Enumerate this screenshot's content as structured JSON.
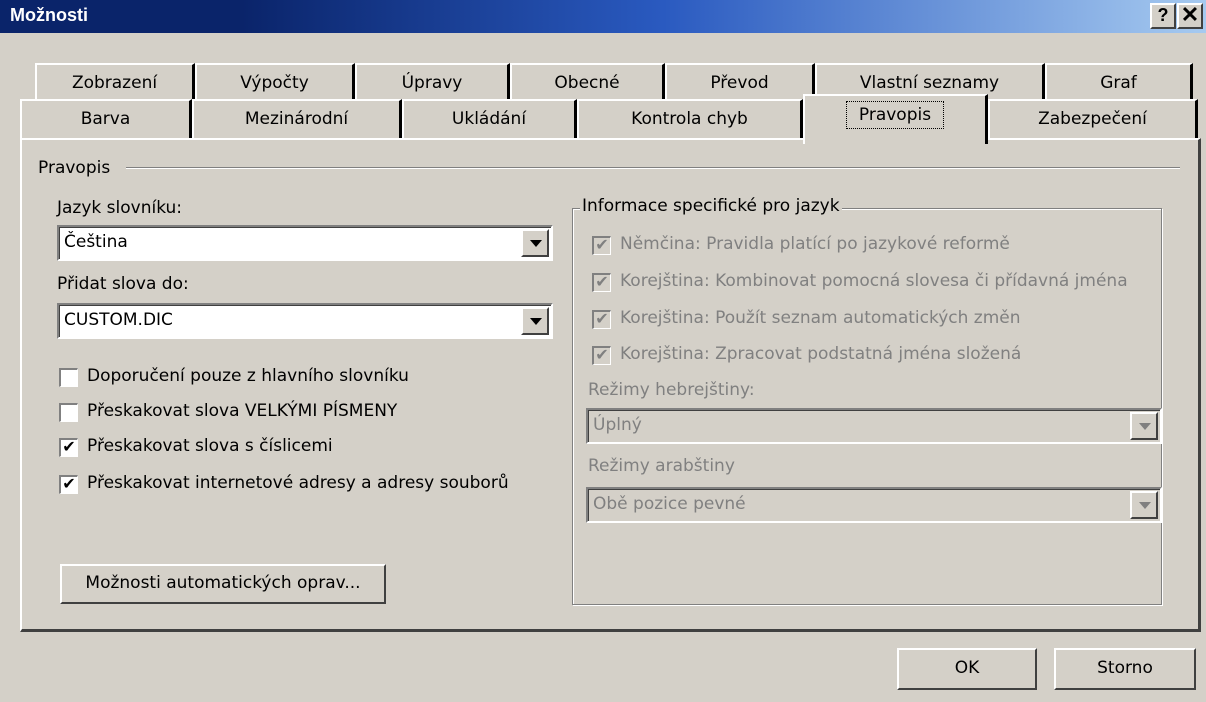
{
  "window": {
    "title": "Možnosti",
    "help_label": "?",
    "close_label": "✕"
  },
  "tabs_row1": [
    "Zobrazení",
    "Výpočty",
    "Úpravy",
    "Obecné",
    "Převod",
    "Vlastní seznamy",
    "Graf"
  ],
  "tabs_row2": [
    "Barva",
    "Mezinárodní",
    "Ukládání",
    "Kontrola chyb",
    "Pravopis",
    "Zabezpečení"
  ],
  "active_tab": "Pravopis",
  "section": {
    "title": "Pravopis"
  },
  "dictionary": {
    "label": "Jazyk slovníku:",
    "value": "Čeština"
  },
  "add_words": {
    "label": "Přidat slova do:",
    "value": "CUSTOM.DIC"
  },
  "options": [
    {
      "label": "Doporučení pouze z hlavního slovníku",
      "checked": false
    },
    {
      "label": "Přeskakovat slova VELKÝMI PÍSMENY",
      "checked": false
    },
    {
      "label": "Přeskakovat slova s číslicemi",
      "checked": true
    },
    {
      "label": "Přeskakovat internetové adresy a adresy souborů",
      "checked": true
    }
  ],
  "autocorrect_button": "Možnosti automatických oprav...",
  "language_group": {
    "title": "Informace specifické pro jazyk",
    "options": [
      {
        "label": "Němčina: Pravidla platící po jazykové reformě",
        "checked": true
      },
      {
        "label": "Korejština: Kombinovat pomocná slovesa či přídavná jména",
        "checked": true
      },
      {
        "label": "Korejština: Použít seznam automatických změn",
        "checked": true
      },
      {
        "label": "Korejština: Zpracovat podstatná jména složená",
        "checked": true
      }
    ],
    "hebrew": {
      "label": "Režimy hebrejštiny:",
      "value": "Úplný"
    },
    "arabic": {
      "label": "Režimy arabštiny",
      "value": "Obě pozice pevné"
    }
  },
  "buttons": {
    "ok": "OK",
    "cancel": "Storno"
  },
  "check_mark": "✔"
}
